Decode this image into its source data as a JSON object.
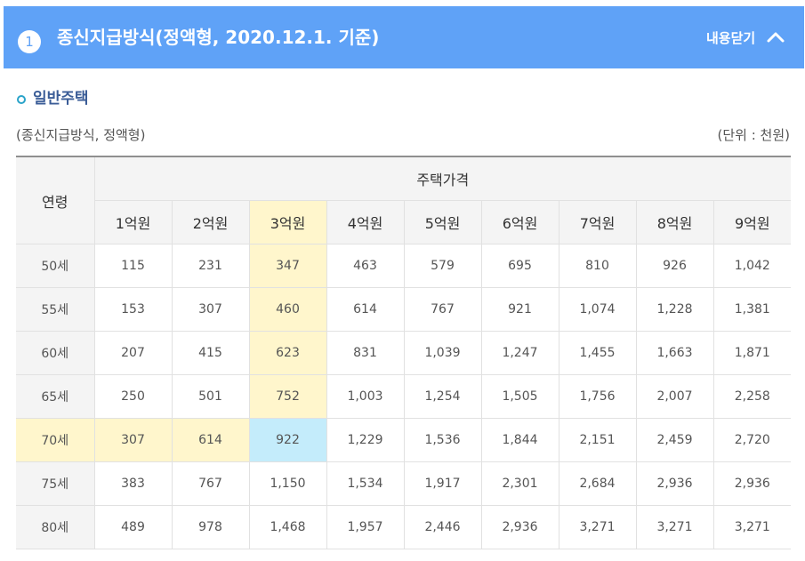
{
  "panel": {
    "number": "1",
    "title": "종신지급방식(정액형, 2020.12.1. 기준)",
    "close_label": "내용닫기",
    "colors": {
      "header": "#5fa2f7",
      "highlight_yellow": "#fff6cc",
      "highlight_blue": "#c4ecfb"
    }
  },
  "section": {
    "title": "일반주택",
    "caption_left": "(종신지급방식, 정액형)",
    "caption_right": "(단위 : 천원)"
  },
  "table": {
    "age_header": "연령",
    "price_header": "주택가격",
    "columns": [
      "1억원",
      "2억원",
      "3억원",
      "4억원",
      "5억원",
      "6억원",
      "7억원",
      "8억원",
      "9억원"
    ],
    "rows": [
      {
        "age": "50세",
        "values": [
          "115",
          "231",
          "347",
          "463",
          "579",
          "695",
          "810",
          "926",
          "1,042"
        ]
      },
      {
        "age": "55세",
        "values": [
          "153",
          "307",
          "460",
          "614",
          "767",
          "921",
          "1,074",
          "1,228",
          "1,381"
        ]
      },
      {
        "age": "60세",
        "values": [
          "207",
          "415",
          "623",
          "831",
          "1,039",
          "1,247",
          "1,455",
          "1,663",
          "1,871"
        ]
      },
      {
        "age": "65세",
        "values": [
          "250",
          "501",
          "752",
          "1,003",
          "1,254",
          "1,505",
          "1,756",
          "2,007",
          "2,258"
        ]
      },
      {
        "age": "70세",
        "values": [
          "307",
          "614",
          "922",
          "1,229",
          "1,536",
          "1,844",
          "2,151",
          "2,459",
          "2,720"
        ]
      },
      {
        "age": "75세",
        "values": [
          "383",
          "767",
          "1,150",
          "1,534",
          "1,917",
          "2,301",
          "2,684",
          "2,936",
          "2,936"
        ]
      },
      {
        "age": "80세",
        "values": [
          "489",
          "978",
          "1,468",
          "1,957",
          "2,446",
          "2,936",
          "3,271",
          "3,271",
          "3,271"
        ]
      }
    ]
  }
}
